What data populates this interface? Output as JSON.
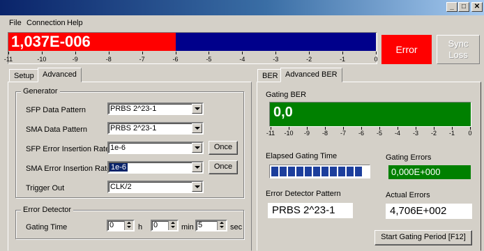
{
  "window": {
    "min_label": "_",
    "max_label": "□",
    "close_label": "✕"
  },
  "menu": [
    "File",
    "Connection",
    "Help"
  ],
  "meter": {
    "value": "1,037E-006",
    "scale": [
      "-11",
      "-10",
      "-9",
      "-8",
      "-7",
      "-6",
      "-5",
      "-4",
      "-3",
      "-2",
      "-1",
      "0"
    ],
    "level_exponent": -6,
    "colors": {
      "fill": "#ff0000",
      "empty": "#00008b"
    }
  },
  "status": {
    "error_label": "Error",
    "sync_label": "Sync\nLoss"
  },
  "left_tabs": [
    {
      "label": "Setup",
      "active": false
    },
    {
      "label": "Advanced",
      "active": true
    }
  ],
  "right_tabs": [
    {
      "label": "BER",
      "active": false
    },
    {
      "label": "Advanced BER",
      "active": true
    }
  ],
  "generator": {
    "title": "Generator",
    "fields": [
      {
        "label": "SFP Data Pattern",
        "value": "PRBS 2^23-1"
      },
      {
        "label": "SMA Data Pattern",
        "value": "PRBS 2^23-1"
      },
      {
        "label": "SFP Error Insertion Rate",
        "value": "1e-6",
        "button": "Once"
      },
      {
        "label": "SMA Error Insertion Rate",
        "value": "1e-6",
        "button": "Once"
      },
      {
        "label": "Trigger Out",
        "value": "CLK/2"
      }
    ]
  },
  "error_detector": {
    "title": "Error Detector",
    "gating_time_label": "Gating Time",
    "h_value": "0",
    "h_unit": "h",
    "min_value": "0",
    "min_unit": "min",
    "sec_value": "5",
    "sec_unit": "sec"
  },
  "advanced_ber": {
    "gating_ber_label": "Gating BER",
    "gating_ber_value": "0,0",
    "scale": [
      "-11",
      "-10",
      "-9",
      "-8",
      "-7",
      "-6",
      "-5",
      "-4",
      "-3",
      "-2",
      "-1",
      "0"
    ],
    "elapsed_label": "Elapsed Gating Time",
    "elapsed_progress": 1.0,
    "gating_errors_label": "Gating Errors",
    "gating_errors_value": "0,000E+000",
    "pattern_label": "Error Detector Pattern",
    "pattern_value": "PRBS 2^23-1",
    "actual_errors_label": "Actual Errors",
    "actual_errors_value": "4,706E+002",
    "start_button": "Start Gating Period  [F12]"
  }
}
